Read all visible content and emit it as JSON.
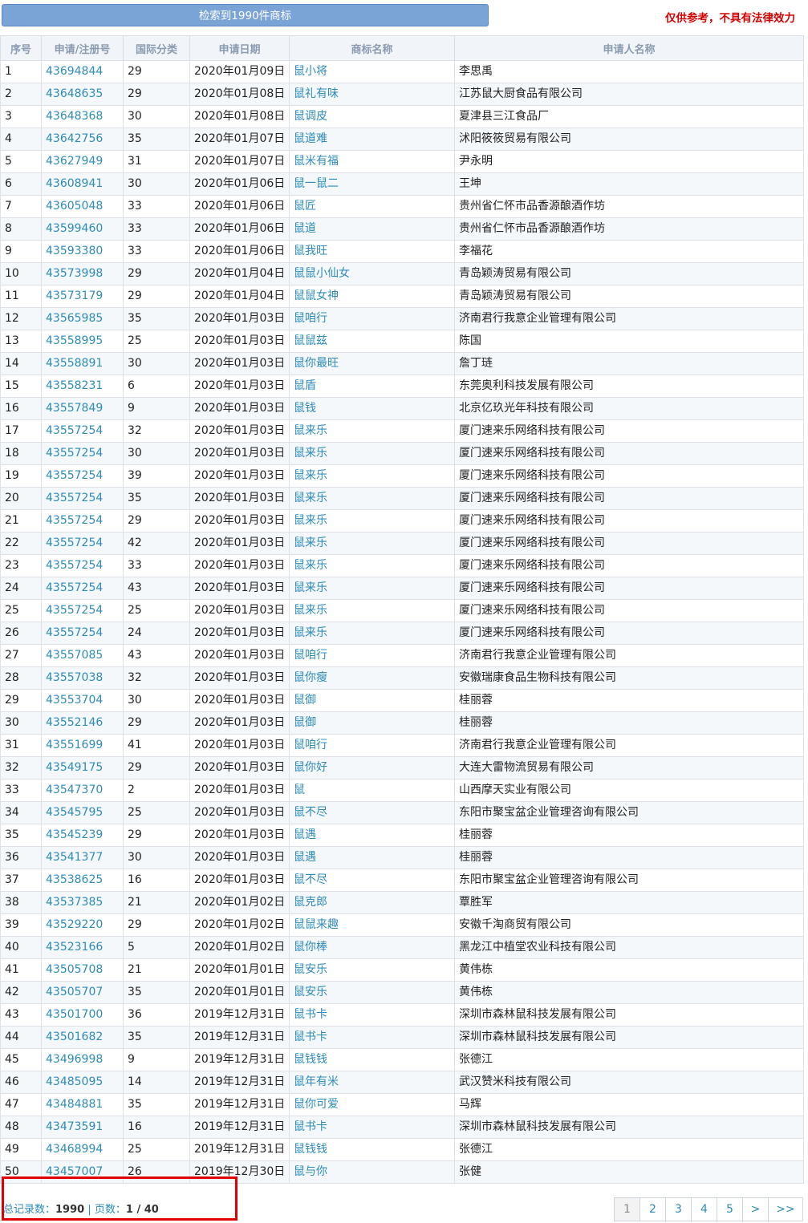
{
  "header": {
    "result_button": "检索到1990件商标",
    "disclaimer": "仅供参考，不具有法律效力"
  },
  "table": {
    "columns": [
      "序号",
      "申请/注册号",
      "国际分类",
      "申请日期",
      "商标名称",
      "申请人名称"
    ],
    "rows": [
      [
        "1",
        "43694844",
        "29",
        "2020年01月09日",
        "鼠小将",
        "李思禹"
      ],
      [
        "2",
        "43648635",
        "29",
        "2020年01月08日",
        "鼠礼有味",
        "江苏鼠大厨食品有限公司"
      ],
      [
        "3",
        "43648368",
        "30",
        "2020年01月08日",
        "鼠调皮",
        "夏津县三江食品厂"
      ],
      [
        "4",
        "43642756",
        "35",
        "2020年01月07日",
        "鼠道难",
        "沭阳筱筱贸易有限公司"
      ],
      [
        "5",
        "43627949",
        "31",
        "2020年01月07日",
        "鼠米有福",
        "尹永明"
      ],
      [
        "6",
        "43608941",
        "30",
        "2020年01月06日",
        "鼠一鼠二",
        "王坤"
      ],
      [
        "7",
        "43605048",
        "33",
        "2020年01月06日",
        "鼠匠",
        "贵州省仁怀市品香源酿酒作坊"
      ],
      [
        "8",
        "43599460",
        "33",
        "2020年01月06日",
        "鼠道",
        "贵州省仁怀市品香源酿酒作坊"
      ],
      [
        "9",
        "43593380",
        "33",
        "2020年01月06日",
        "鼠我旺",
        "李福花"
      ],
      [
        "10",
        "43573998",
        "29",
        "2020年01月04日",
        "鼠鼠小仙女",
        "青岛颖涛贸易有限公司"
      ],
      [
        "11",
        "43573179",
        "29",
        "2020年01月04日",
        "鼠鼠女神",
        "青岛颖涛贸易有限公司"
      ],
      [
        "12",
        "43565985",
        "35",
        "2020年01月03日",
        "鼠咱行",
        "济南君行我意企业管理有限公司"
      ],
      [
        "13",
        "43558995",
        "25",
        "2020年01月03日",
        "鼠鼠兹",
        "陈国"
      ],
      [
        "14",
        "43558891",
        "30",
        "2020年01月03日",
        "鼠你最旺",
        "詹丁琏"
      ],
      [
        "15",
        "43558231",
        "6",
        "2020年01月03日",
        "鼠盾",
        "东莞奥利科技发展有限公司"
      ],
      [
        "16",
        "43557849",
        "9",
        "2020年01月03日",
        "鼠钱",
        "北京亿玖光年科技有限公司"
      ],
      [
        "17",
        "43557254",
        "32",
        "2020年01月03日",
        "鼠来乐",
        "厦门速来乐网络科技有限公司"
      ],
      [
        "18",
        "43557254",
        "30",
        "2020年01月03日",
        "鼠来乐",
        "厦门速来乐网络科技有限公司"
      ],
      [
        "19",
        "43557254",
        "39",
        "2020年01月03日",
        "鼠来乐",
        "厦门速来乐网络科技有限公司"
      ],
      [
        "20",
        "43557254",
        "35",
        "2020年01月03日",
        "鼠来乐",
        "厦门速来乐网络科技有限公司"
      ],
      [
        "21",
        "43557254",
        "29",
        "2020年01月03日",
        "鼠来乐",
        "厦门速来乐网络科技有限公司"
      ],
      [
        "22",
        "43557254",
        "42",
        "2020年01月03日",
        "鼠来乐",
        "厦门速来乐网络科技有限公司"
      ],
      [
        "23",
        "43557254",
        "33",
        "2020年01月03日",
        "鼠来乐",
        "厦门速来乐网络科技有限公司"
      ],
      [
        "24",
        "43557254",
        "43",
        "2020年01月03日",
        "鼠来乐",
        "厦门速来乐网络科技有限公司"
      ],
      [
        "25",
        "43557254",
        "25",
        "2020年01月03日",
        "鼠来乐",
        "厦门速来乐网络科技有限公司"
      ],
      [
        "26",
        "43557254",
        "24",
        "2020年01月03日",
        "鼠来乐",
        "厦门速来乐网络科技有限公司"
      ],
      [
        "27",
        "43557085",
        "43",
        "2020年01月03日",
        "鼠咱行",
        "济南君行我意企业管理有限公司"
      ],
      [
        "28",
        "43557038",
        "32",
        "2020年01月03日",
        "鼠你瘦",
        "安徽瑞康食品生物科技有限公司"
      ],
      [
        "29",
        "43553704",
        "30",
        "2020年01月03日",
        "鼠御",
        "桂丽蓉"
      ],
      [
        "30",
        "43552146",
        "29",
        "2020年01月03日",
        "鼠御",
        "桂丽蓉"
      ],
      [
        "31",
        "43551699",
        "41",
        "2020年01月03日",
        "鼠咱行",
        "济南君行我意企业管理有限公司"
      ],
      [
        "32",
        "43549175",
        "29",
        "2020年01月03日",
        "鼠你好",
        "大连大雷物流贸易有限公司"
      ],
      [
        "33",
        "43547370",
        "2",
        "2020年01月03日",
        "鼠",
        "山西摩天实业有限公司"
      ],
      [
        "34",
        "43545795",
        "25",
        "2020年01月03日",
        "鼠不尽",
        "东阳市聚宝盆企业管理咨询有限公司"
      ],
      [
        "35",
        "43545239",
        "29",
        "2020年01月03日",
        "鼠遇",
        "桂丽蓉"
      ],
      [
        "36",
        "43541377",
        "30",
        "2020年01月03日",
        "鼠遇",
        "桂丽蓉"
      ],
      [
        "37",
        "43538625",
        "16",
        "2020年01月03日",
        "鼠不尽",
        "东阳市聚宝盆企业管理咨询有限公司"
      ],
      [
        "38",
        "43537385",
        "21",
        "2020年01月02日",
        "鼠克郎",
        "覃胜军"
      ],
      [
        "39",
        "43529220",
        "29",
        "2020年01月02日",
        "鼠鼠来趣",
        "安徽千淘商贸有限公司"
      ],
      [
        "40",
        "43523166",
        "5",
        "2020年01月02日",
        "鼠你棒",
        "黑龙江中植堂农业科技有限公司"
      ],
      [
        "41",
        "43505708",
        "21",
        "2020年01月01日",
        "鼠安乐",
        "黄伟栋"
      ],
      [
        "42",
        "43505707",
        "35",
        "2020年01月01日",
        "鼠安乐",
        "黄伟栋"
      ],
      [
        "43",
        "43501700",
        "36",
        "2019年12月31日",
        "鼠书卡",
        "深圳市森林鼠科技发展有限公司"
      ],
      [
        "44",
        "43501682",
        "35",
        "2019年12月31日",
        "鼠书卡",
        "深圳市森林鼠科技发展有限公司"
      ],
      [
        "45",
        "43496998",
        "9",
        "2019年12月31日",
        "鼠钱钱",
        "张德江"
      ],
      [
        "46",
        "43485095",
        "14",
        "2019年12月31日",
        "鼠年有米",
        "武汉赞米科技有限公司"
      ],
      [
        "47",
        "43484881",
        "35",
        "2019年12月31日",
        "鼠你可爱",
        "马辉"
      ],
      [
        "48",
        "43473591",
        "16",
        "2019年12月31日",
        "鼠书卡",
        "深圳市森林鼠科技发展有限公司"
      ],
      [
        "49",
        "43468994",
        "25",
        "2019年12月31日",
        "鼠钱钱",
        "张德江"
      ],
      [
        "50",
        "43457007",
        "26",
        "2019年12月30日",
        "鼠与你",
        "张健"
      ]
    ]
  },
  "footer": {
    "total_label": "总记录数：",
    "total_value": "1990",
    "separator": " | ",
    "pages_label": "页数：",
    "pages_value": "1 / 40"
  },
  "pager": [
    "1",
    "2",
    "3",
    "4",
    "5",
    ">",
    ">>"
  ],
  "colors": {
    "link": "#2e8bb8",
    "highlight_box": "#e00000",
    "disclaimer": "#d40000"
  }
}
